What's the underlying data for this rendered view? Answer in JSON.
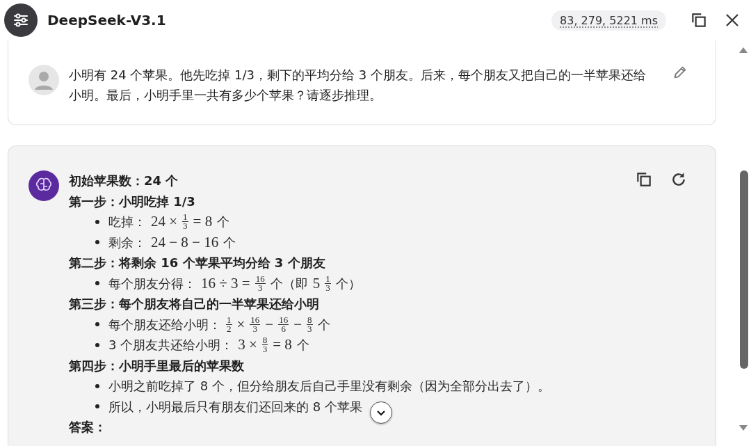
{
  "header": {
    "title": "DeepSeek-V3.1",
    "stats": "83, 279, 5221 ms"
  },
  "user_message": {
    "text": "小明有 24 个苹果。他先吃掉 1/3，剩下的平均分给 3 个朋友。后来，每个朋友又把自己的一半苹果还给小明。最后，小明手里一共有多少个苹果？请逐步推理。"
  },
  "assistant_message": {
    "content": [
      {
        "kind": "heading",
        "text": "初始苹果数：24 个"
      },
      {
        "kind": "heading",
        "text": "第一步：小明吃掉 1/3"
      },
      {
        "kind": "bullet",
        "parts": [
          {
            "kind": "text",
            "text": "吃掉："
          },
          {
            "kind": "math",
            "text": "24 ×"
          },
          {
            "kind": "frac",
            "num": "1",
            "den": "3"
          },
          {
            "kind": "math",
            "text": "= 8"
          },
          {
            "kind": "text",
            "text": "个"
          }
        ]
      },
      {
        "kind": "bullet",
        "parts": [
          {
            "kind": "text",
            "text": "剩余："
          },
          {
            "kind": "math",
            "text": "24 − 8 − 16"
          },
          {
            "kind": "text",
            "text": "个"
          }
        ]
      },
      {
        "kind": "heading",
        "text": "第二步：将剩余 16 个苹果平均分给 3 个朋友"
      },
      {
        "kind": "bullet",
        "parts": [
          {
            "kind": "text",
            "text": "每个朋友分得："
          },
          {
            "kind": "math",
            "text": "16 ÷ 3 ="
          },
          {
            "kind": "frac",
            "num": "16",
            "den": "3"
          },
          {
            "kind": "text",
            "text": "个（即"
          },
          {
            "kind": "math",
            "text": "5"
          },
          {
            "kind": "frac",
            "num": "1",
            "den": "3"
          },
          {
            "kind": "text",
            "text": "个）"
          }
        ]
      },
      {
        "kind": "heading",
        "text": "第三步：每个朋友将自己的一半苹果还给小明"
      },
      {
        "kind": "bullet",
        "parts": [
          {
            "kind": "text",
            "text": "每个朋友还给小明："
          },
          {
            "kind": "frac",
            "num": "1",
            "den": "2"
          },
          {
            "kind": "math",
            "text": "×"
          },
          {
            "kind": "frac",
            "num": "16",
            "den": "3"
          },
          {
            "kind": "math",
            "text": "−"
          },
          {
            "kind": "frac",
            "num": "16",
            "den": "6"
          },
          {
            "kind": "math",
            "text": "−"
          },
          {
            "kind": "frac",
            "num": "8",
            "den": "3"
          },
          {
            "kind": "text",
            "text": "个"
          }
        ]
      },
      {
        "kind": "bullet",
        "parts": [
          {
            "kind": "text",
            "text": "3 个朋友共还给小明："
          },
          {
            "kind": "math",
            "text": "3 ×"
          },
          {
            "kind": "frac",
            "num": "8",
            "den": "3"
          },
          {
            "kind": "math",
            "text": "= 8"
          },
          {
            "kind": "text",
            "text": "个"
          }
        ]
      },
      {
        "kind": "heading",
        "text": "第四步：小明手里最后的苹果数"
      },
      {
        "kind": "bullet",
        "parts": [
          {
            "kind": "text",
            "text": "小明之前吃掉了 8 个，但分给朋友后自己手里没有剩余（因为全部分出去了）。"
          }
        ]
      },
      {
        "kind": "bullet",
        "parts": [
          {
            "kind": "text",
            "text": "所以，小明最后只有朋友们还回来的 8 个苹果"
          }
        ]
      },
      {
        "kind": "heading",
        "text": "答案："
      }
    ]
  }
}
